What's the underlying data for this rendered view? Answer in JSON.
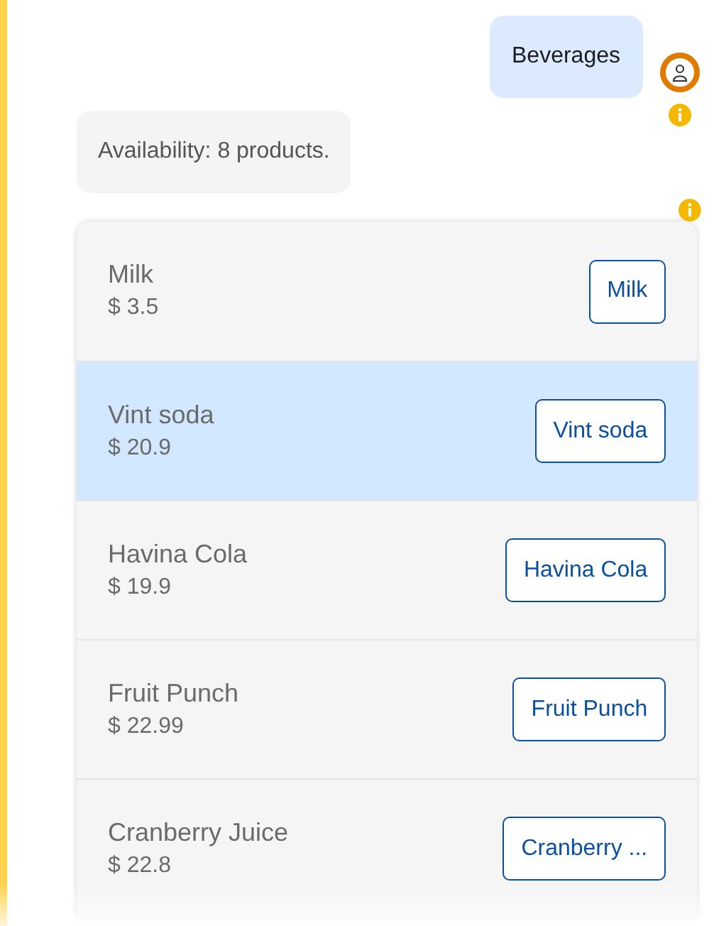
{
  "user_message": {
    "text": "Beverages"
  },
  "bot_message": {
    "text": "Availability: 8 products."
  },
  "products": [
    {
      "name": "Milk",
      "price": "$ 3.5",
      "button": "Milk",
      "selected": false
    },
    {
      "name": "Vint soda",
      "price": "$ 20.9",
      "button": "Vint soda",
      "selected": true
    },
    {
      "name": "Havina Cola",
      "price": "$ 19.9",
      "button": "Havina Cola",
      "selected": false
    },
    {
      "name": "Fruit Punch",
      "price": "$ 22.99",
      "button": "Fruit Punch",
      "selected": false
    },
    {
      "name": "Cranberry Juice",
      "price": "$ 22.8",
      "button": "Cranberry ...",
      "selected": false
    }
  ]
}
